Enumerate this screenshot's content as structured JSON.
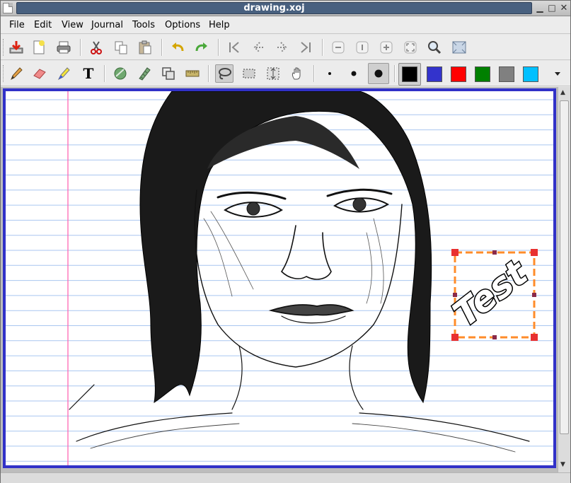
{
  "window": {
    "title": "drawing.xoj"
  },
  "menu": {
    "items": [
      "File",
      "Edit",
      "View",
      "Journal",
      "Tools",
      "Options",
      "Help"
    ]
  },
  "toolbar_main": {
    "icons": [
      "save-icon",
      "new-page-icon",
      "print-icon",
      "cut-icon",
      "copy-icon",
      "paste-icon",
      "undo-icon",
      "redo-icon",
      "first-page-icon",
      "previous-page-icon",
      "next-page-icon",
      "last-page-icon",
      "zoom-out-icon",
      "zoom-normal-icon",
      "zoom-in-icon",
      "fullscreen-icon",
      "find-icon",
      "page-width-icon"
    ]
  },
  "toolbar_tools": {
    "icons": [
      "pen-icon",
      "eraser-icon",
      "highlighter-icon",
      "text-icon",
      "shape-recognizer-icon",
      "ruler-icon",
      "default-tools-icon",
      "settings-icon",
      "select-lasso-icon",
      "select-rect-icon",
      "vertical-space-icon",
      "hand-icon",
      "thin-dot-icon",
      "medium-dot-icon",
      "thick-dot-icon"
    ],
    "active_tool": "select-lasso",
    "colors": [
      "#000000",
      "#3333cc",
      "#ff0000",
      "#008000",
      "#808080",
      "#00c0ff"
    ],
    "selected_color": "#000000"
  },
  "document": {
    "page_border_color": "#3131c8",
    "rule_color": "#a9c6f0",
    "margin_color": "#ff66b4",
    "selection_color": "#ff8c2a",
    "selected_text": "Test"
  }
}
